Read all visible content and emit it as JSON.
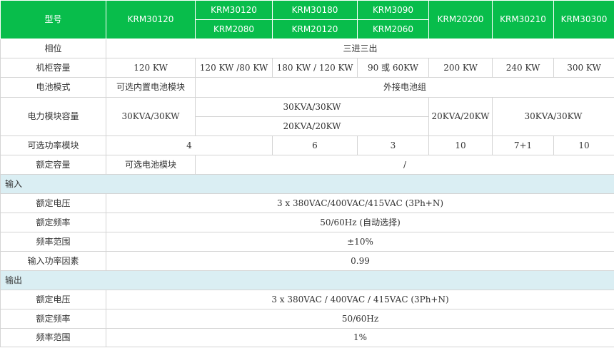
{
  "colors": {
    "header_bg": "#08bd4b",
    "header_text": "#ffffff",
    "section_bg": "#daeef3",
    "border": "#d4d4d4"
  },
  "header": {
    "model_label": "型号",
    "c1": "KRM30120",
    "c2_top": "KRM30120",
    "c2_bottom": "KRM2080",
    "c3_top": "KRM30180",
    "c3_bottom": "KRM20120",
    "c4_top": "KRM3090",
    "c4_bottom": "KRM2060",
    "c5": "KRM20200",
    "c6": "KRM30210",
    "c7": "KRM30300"
  },
  "rows": {
    "phase": {
      "label": "相位",
      "value": "三进三出"
    },
    "capacity": {
      "label": "机柜容量",
      "values": [
        "120 KW",
        "120 KW /80 KW",
        "180 KW / 120 KW",
        "90 或 60KW",
        "200 KW",
        "240 KW",
        "300 KW"
      ]
    },
    "battery_mode": {
      "label": "电池模式",
      "v1": "可选内置电池模块",
      "v2": "外接电池组"
    },
    "module_capacity": {
      "label": "电力模块容量",
      "v1": "30KVA/30KW",
      "v2_top": "30KVA/30KW",
      "v2_bottom": "20KVA/20KW",
      "v3": "20KVA/20KW",
      "v4": "30KVA/30KW"
    },
    "optional_modules": {
      "label": "可选功率模块",
      "v1": "4",
      "v2": "6",
      "v3": "3",
      "v4": "10",
      "v5": "7+1",
      "v6": "10"
    },
    "rated_capacity": {
      "label": "额定容量",
      "v1": "可选电池模块",
      "v2": "/"
    }
  },
  "input": {
    "title": "输入",
    "rated_voltage": {
      "label": "额定电压",
      "value": "3 x 380VAC/400VAC/415VAC (3Ph+N)"
    },
    "rated_freq": {
      "label": "额定频率",
      "value": "50/60Hz (自动选择)"
    },
    "freq_range": {
      "label": "频率范围",
      "value": "±10%"
    },
    "power_factor": {
      "label": "输入功率因素",
      "value": "0.99"
    }
  },
  "output": {
    "title": "输出",
    "rated_voltage": {
      "label": "额定电压",
      "value": "3 x 380VAC / 400VAC / 415VAC (3Ph+N)"
    },
    "rated_freq": {
      "label": "额定频率",
      "value": "50/60Hz"
    },
    "freq_range": {
      "label": "频率范围",
      "value": "1%"
    }
  }
}
